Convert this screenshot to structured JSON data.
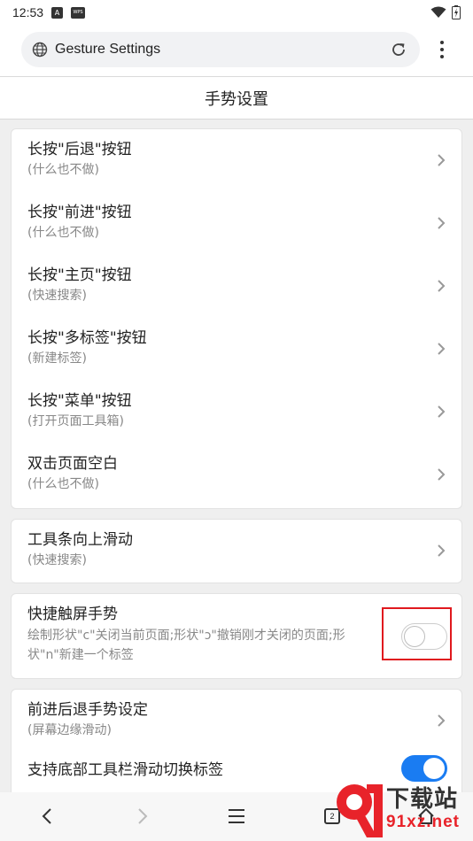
{
  "status_bar": {
    "time": "12:53",
    "icon_a": "A",
    "icon_b": "WPS"
  },
  "url_bar": {
    "text": "Gesture Settings"
  },
  "page": {
    "title": "手势设置"
  },
  "group1": {
    "items": [
      {
        "title": "长按\"后退\"按钮",
        "subtitle": "(什么也不做)"
      },
      {
        "title": "长按\"前进\"按钮",
        "subtitle": "(什么也不做)"
      },
      {
        "title": "长按\"主页\"按钮",
        "subtitle": "(快速搜索)"
      },
      {
        "title": "长按\"多标签\"按钮",
        "subtitle": "(新建标签)"
      },
      {
        "title": "长按\"菜单\"按钮",
        "subtitle": "(打开页面工具箱)"
      },
      {
        "title": "双击页面空白",
        "subtitle": "(什么也不做)"
      }
    ]
  },
  "group2": {
    "title": "工具条向上滑动",
    "subtitle": "(快速搜索)"
  },
  "group3": {
    "title": "快捷触屏手势",
    "description": "绘制形状\"c\"关闭当前页面;形状\"ɔ\"撤销刚才关闭的页面;形状\"n\"新建一个标签",
    "toggle_on": false
  },
  "group4": {
    "title": "前进后退手势设定",
    "subtitle": "(屏幕边缘滑动)",
    "switch_title": "支持底部工具栏滑动切换标签",
    "switch_on": true
  },
  "bottom_nav": {
    "tab_count": "2"
  },
  "watermark": {
    "line1": "下载站",
    "line2": "91xz.net"
  },
  "colors": {
    "accent": "#1a7cf2",
    "highlight": "#e0191e",
    "watermark_red": "#e8232a"
  }
}
